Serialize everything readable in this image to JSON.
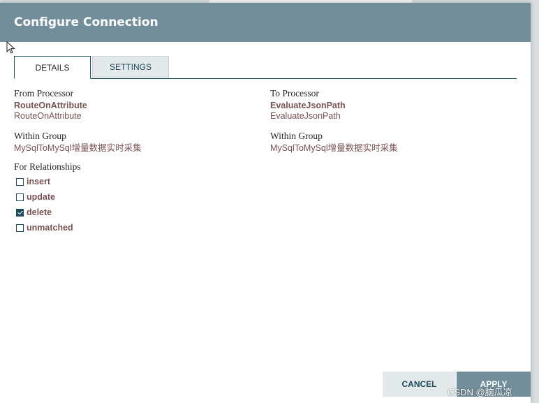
{
  "dialog": {
    "title": "Configure Connection"
  },
  "tabs": [
    {
      "label": "DETAILS",
      "active": true
    },
    {
      "label": "SETTINGS",
      "active": false
    }
  ],
  "from": {
    "heading": "From Processor",
    "name": "RouteOnAttribute",
    "type": "RouteOnAttribute",
    "group_heading": "Within Group",
    "group": "MySqlToMySql增量数据实时采集"
  },
  "to": {
    "heading": "To Processor",
    "name": "EvaluateJsonPath",
    "type": "EvaluateJsonPath",
    "group_heading": "Within Group",
    "group": "MySqlToMySql增量数据实时采集"
  },
  "relationships": {
    "heading": "For Relationships",
    "items": [
      {
        "label": "insert",
        "checked": false
      },
      {
        "label": "update",
        "checked": false
      },
      {
        "label": "delete",
        "checked": true
      },
      {
        "label": "unmatched",
        "checked": false
      }
    ]
  },
  "buttons": {
    "cancel": "CANCEL",
    "apply": "APPLY"
  },
  "watermark": "CSDN @脑瓜凉",
  "colors": {
    "header": "#728e9b",
    "accent": "#1d4a5a",
    "value_text": "#775351"
  }
}
